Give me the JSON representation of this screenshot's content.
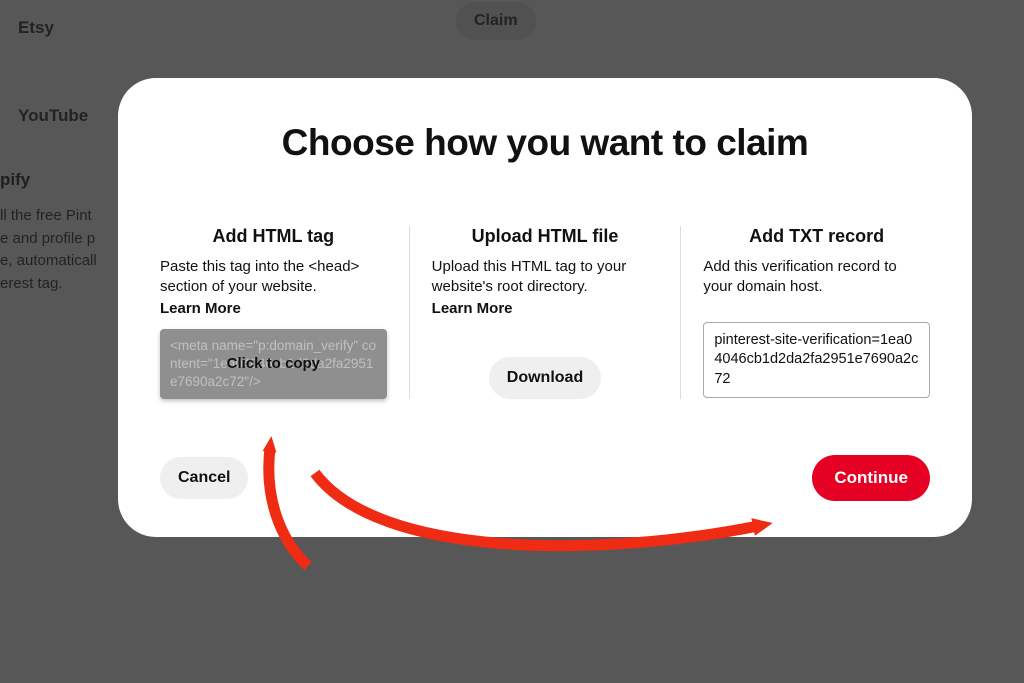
{
  "background": {
    "etsy": "Etsy",
    "youtube": "YouTube",
    "claim_btn": "Claim",
    "shopify_label": "pify",
    "shopify_desc": "ll the free Pint\ne and profile p\ne, automaticall\nerest tag."
  },
  "modal": {
    "title": "Choose how you want to claim",
    "options": {
      "html_tag": {
        "title": "Add HTML tag",
        "desc": "Paste this tag into the <head> section of your website.",
        "learn_more": "Learn More",
        "code": "<meta name=\"p:domain_verify\" content=\"1ea04046cb1d2da2fa2951e7690a2c72\"/>",
        "copy_label": "Click to copy"
      },
      "html_file": {
        "title": "Upload HTML file",
        "desc": "Upload this HTML tag to your website's root directory.",
        "learn_more": "Learn More",
        "download_btn": "Download"
      },
      "txt_record": {
        "title": "Add TXT record",
        "desc": "Add this verification record to your domain host.",
        "value": "pinterest-site-verification=1ea04046cb1d2da2fa2951e7690a2c72"
      }
    },
    "cancel_btn": "Cancel",
    "continue_btn": "Continue"
  }
}
